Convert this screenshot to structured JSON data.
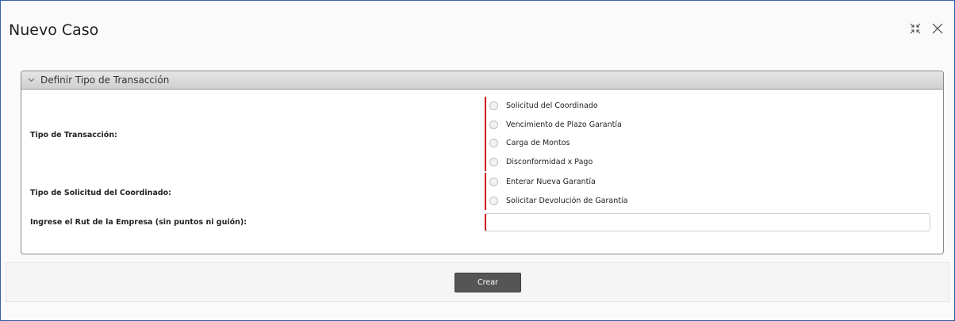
{
  "dialog": {
    "title": "Nuevo Caso",
    "icons": [
      "collapse-icon",
      "close-icon"
    ]
  },
  "panel": {
    "header": "Definir Tipo de Transacción",
    "rows": {
      "tipo_transaccion": {
        "label": "Tipo de Transacción:",
        "options": [
          "Solicitud del Coordinado",
          "Vencimiento de Plazo Garantía",
          "Carga de Montos",
          "Disconformidad x Pago"
        ]
      },
      "tipo_solicitud": {
        "label": "Tipo de Solicitud del Coordinado:",
        "options": [
          "Enterar Nueva Garantía",
          "Solicitar Devolución de Garantía"
        ]
      },
      "rut": {
        "label": "Ingrese el Rut de la Empresa (sin puntos ni guión):",
        "value": ""
      }
    }
  },
  "footer": {
    "crear_label": "Crear"
  },
  "colors": {
    "required_marker": "#d0021b",
    "button_bg": "#555555",
    "dialog_border": "#3b5fa8"
  }
}
